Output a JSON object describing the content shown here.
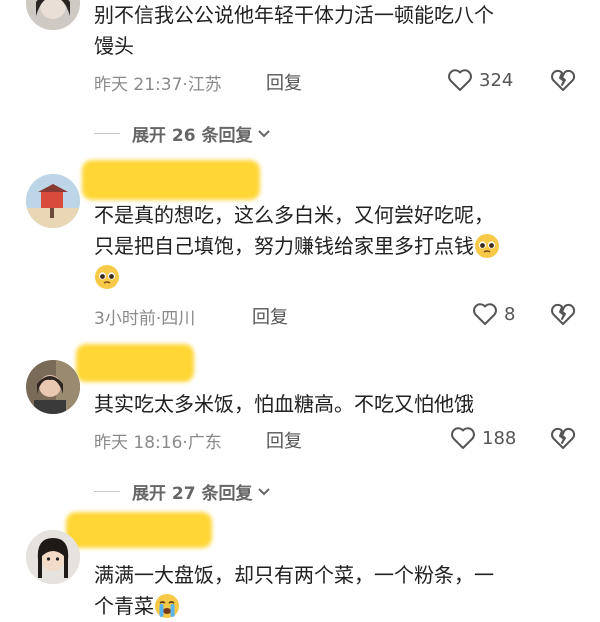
{
  "comments": [
    {
      "text_lines": [
        "别不信我公公说他年轻干体力活一顿能吃八个",
        "馒头"
      ],
      "time": "昨天 21:37",
      "location": "江苏",
      "reply_label": "回复",
      "likes": "324"
    },
    {
      "text_lines": [
        "不是真的想吃，这么多白米，又何尝好吃呢，",
        "只是把自己填饱，努力赚钱给家里多打点钱"
      ],
      "time": "3小时前",
      "location": "四川",
      "reply_label": "回复",
      "likes": "8"
    },
    {
      "text_lines": [
        "其实吃太多米饭，怕血糖高。不吃又怕他饿"
      ],
      "time": "昨天 18:16",
      "location": "广东",
      "reply_label": "回复",
      "likes": "188"
    },
    {
      "text_lines": [
        "满满一大盘饭，却只有两个菜，一个粉条，一",
        "个青菜"
      ]
    }
  ],
  "expanders": [
    {
      "label": "展开 26 条回复"
    },
    {
      "label": "展开 27 条回复"
    }
  ],
  "meta_separator": "·",
  "colors": {
    "name_redaction": "#ffd42a",
    "meta_text": "#8a8a8a"
  }
}
